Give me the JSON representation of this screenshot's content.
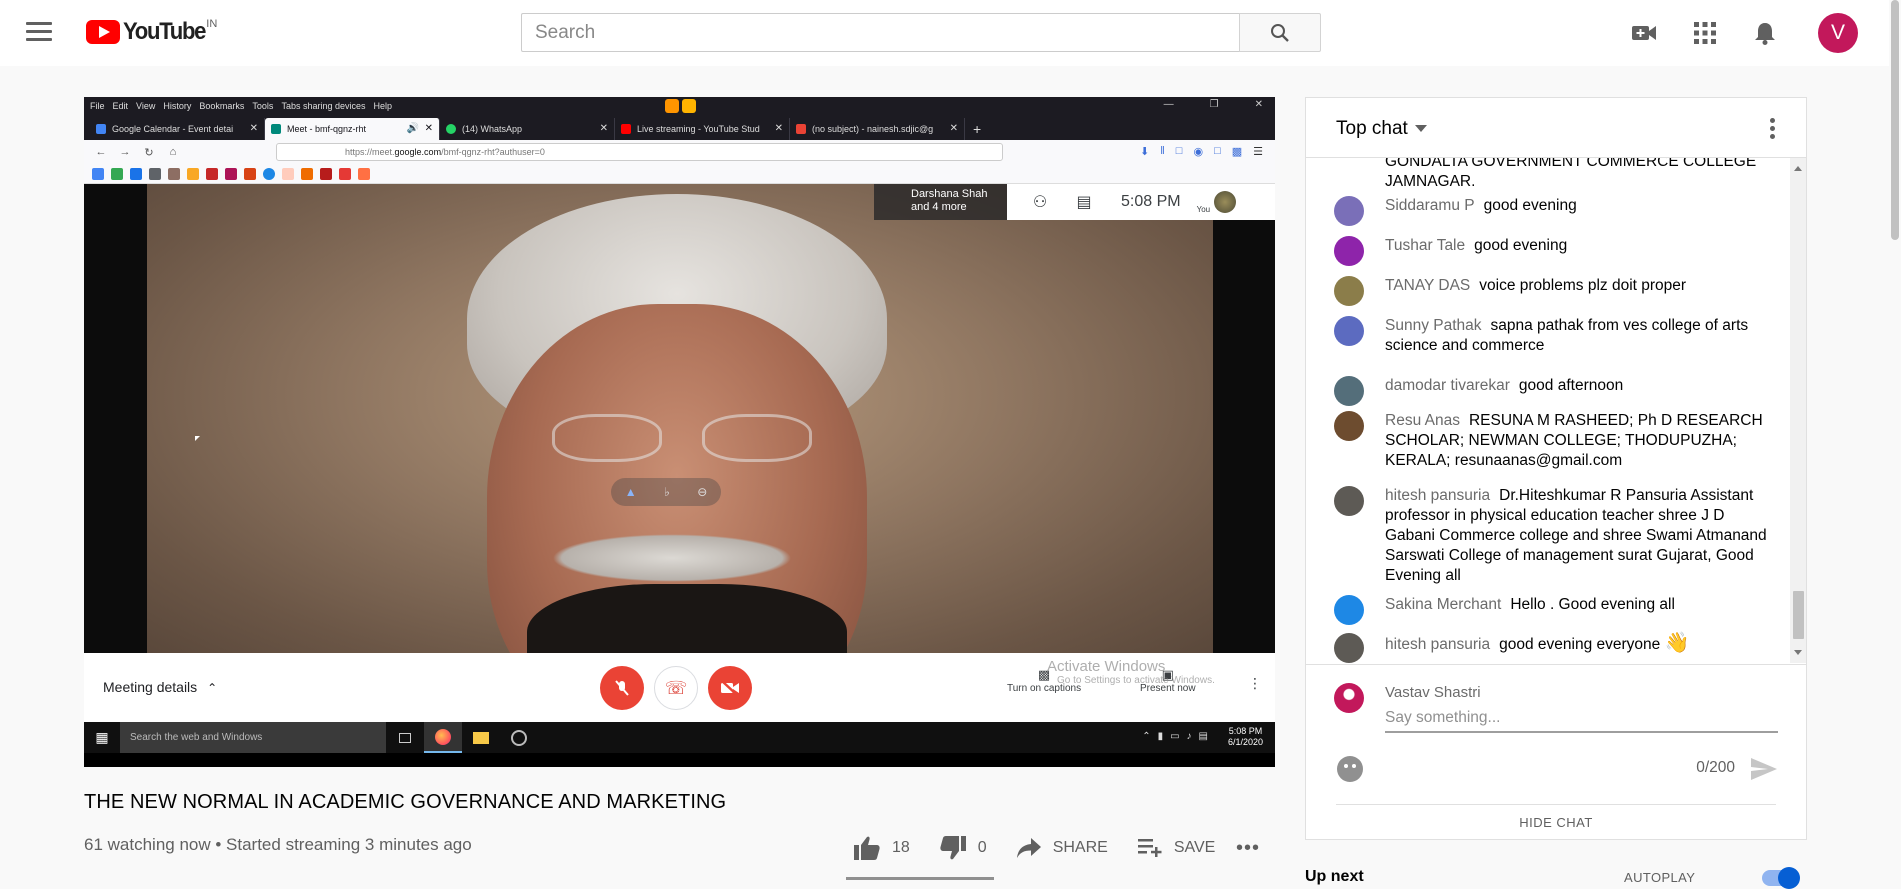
{
  "masthead": {
    "logo_text": "YouTube",
    "country_code": "IN",
    "search_placeholder": "Search",
    "avatar_letter": "V"
  },
  "player": {
    "firefox": {
      "menu": [
        "File",
        "Edit",
        "View",
        "History",
        "Bookmarks",
        "Tools",
        "Tabs sharing devices",
        "Help"
      ],
      "tabs": [
        {
          "label": "Google Calendar - Event detai",
          "color": "#4285f4"
        },
        {
          "label": "Meet - bmf-qgnz-rht",
          "color": "#00897b"
        },
        {
          "label": "(14) WhatsApp",
          "color": "#25d366"
        },
        {
          "label": "Live streaming - YouTube Stud",
          "color": "#ff0000"
        },
        {
          "label": "(no subject) - nainesh.sdjic@g",
          "color": "#ea4335"
        }
      ],
      "url_prefix": "https://meet.",
      "url_domain": "google.com",
      "url_suffix": "/bmf-qgnz-rht?authuser=0"
    },
    "meet": {
      "participants_line1": "Darshana Shah",
      "participants_line2": "and 4 more",
      "time": "5:08 PM",
      "you_label": "You",
      "meeting_details": "Meeting details",
      "turn_on_captions": "Turn on captions",
      "present_now": "Present now",
      "activate_windows": "Activate Windows",
      "activate_sub": "Go to Settings to activate Windows."
    },
    "taskbar": {
      "search_text": "Search the web and Windows",
      "clock_time": "5:08 PM",
      "clock_date": "6/1/2020"
    }
  },
  "video": {
    "title": "THE NEW NORMAL IN ACADEMIC GOVERNANCE AND MARKETING",
    "meta": "61 watching now • Started streaming 3 minutes ago",
    "likes": "18",
    "dislikes": "0",
    "share_label": "SHARE",
    "save_label": "SAVE",
    "like_ratio": 1.0
  },
  "chat": {
    "title": "Top chat",
    "clipped_text": "JAMNAGAR.",
    "clipped_text_top": "GONDALTA GOVERNMENT COMMERCE COLLEGE",
    "messages": [
      {
        "author": "Siddaramu P",
        "text": "good evening",
        "avatar_color": "#7a6fb8"
      },
      {
        "author": "Tushar Tale",
        "text": "good evening",
        "avatar_color": "#8e24aa"
      },
      {
        "author": "TANAY DAS",
        "text": "voice problems plz doit proper",
        "avatar_color": "#8b7d4a"
      },
      {
        "author": "Sunny Pathak",
        "text": "sapna pathak from ves college of arts science and commerce",
        "avatar_color": "#5c6bc0"
      },
      {
        "author": "damodar tivarekar",
        "text": "good afternoon",
        "avatar_color": "#546e7a"
      },
      {
        "author": "Resu Anas",
        "text": "RESUNA M RASHEED; Ph D RESEARCH SCHOLAR; NEWMAN COLLEGE; THODUPUZHA; KERALA; resunaanas@gmail.com",
        "avatar_color": "#6d4c2f"
      },
      {
        "author": "hitesh pansuria",
        "text": "Dr.Hiteshkumar R Pansuria Assistant professor in physical education teacher shree J D Gabani Commerce college and shree Swami Atmanand Sarswati College of management surat Gujarat, Good Evening all",
        "avatar_color": "#5d5a55"
      },
      {
        "author": "Sakina Merchant",
        "text": "Hello . Good evening all",
        "avatar_color": "#1e88e5"
      },
      {
        "author": "hitesh pansuria",
        "text": "good evening everyone",
        "avatar_color": "#5d5a55",
        "emoji": "👋"
      }
    ],
    "current_user": "Vastav Shastri",
    "input_placeholder": "Say something...",
    "char_count": "0/200",
    "hide_chat": "HIDE CHAT"
  },
  "sidebar": {
    "up_next": "Up next",
    "autoplay": "AUTOPLAY"
  },
  "colors": {
    "brand_red": "#ff0000",
    "meet_red": "#ea4335",
    "link_blue": "#065fd4"
  }
}
